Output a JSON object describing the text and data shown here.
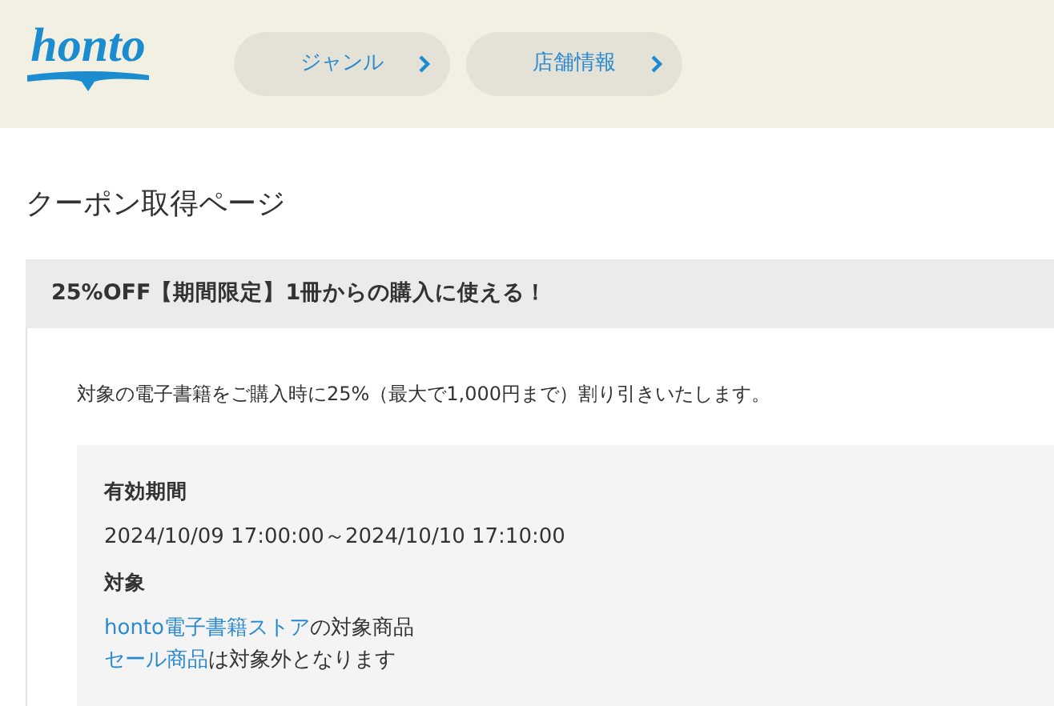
{
  "header": {
    "logo": "honto",
    "nav": [
      {
        "label": "ジャンル"
      },
      {
        "label": "店舗情報"
      }
    ]
  },
  "page_title": "クーポン取得ページ",
  "coupon": {
    "title": "25%OFF【期間限定】1冊からの購入に使える！",
    "description": "対象の電子書籍をご購入時に25%（最大で1,000円まで）割り引きいたします。",
    "details": [
      {
        "heading": "有効期間",
        "lines": [
          {
            "text": "2024/10/09 17:00:00～2024/10/10 17:10:00"
          }
        ]
      },
      {
        "heading": "対象",
        "lines": [
          {
            "link": "honto電子書籍ストア",
            "text": "の対象商品"
          },
          {
            "link": "セール商品",
            "text": "は対象外となります"
          }
        ]
      }
    ]
  }
}
